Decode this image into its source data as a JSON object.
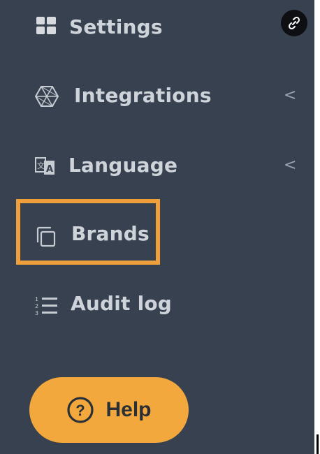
{
  "sidebar": {
    "items": [
      {
        "label": "Settings",
        "icon": "grid-icon"
      },
      {
        "label": "Integrations",
        "icon": "hexagon-mesh-icon",
        "chevron": "<"
      },
      {
        "label": "Language",
        "icon": "translate-icon",
        "chevron": "<"
      },
      {
        "label": "Brands",
        "icon": "copy-squares-icon"
      },
      {
        "label": "Audit log",
        "icon": "numbered-list-icon"
      }
    ],
    "link_badge_icon": "link-icon"
  },
  "help": {
    "label": "Help",
    "icon": "question-circle-icon"
  },
  "colors": {
    "sidebar_bg": "#374150",
    "text": "#cfd4db",
    "accent": "#f2a83c",
    "highlight": "#f0a03a"
  }
}
